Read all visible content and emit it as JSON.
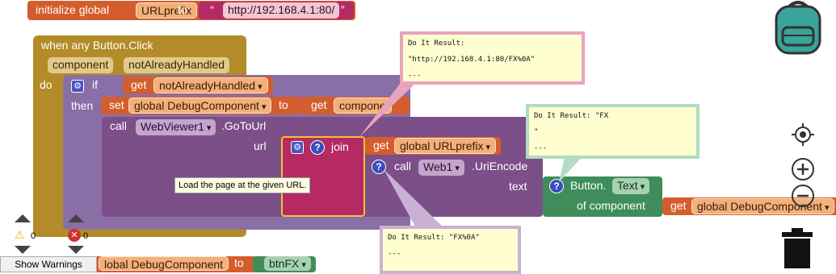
{
  "init_global": {
    "keyword": "initialize global",
    "var_name": "URLprefix",
    "to": "to",
    "open_quote": "“",
    "string_value": "http://192.168.4.1:80/",
    "close_quote": "”"
  },
  "event": {
    "title": "when any Button.Click",
    "param1": "component",
    "param2": "notAlreadyHandled",
    "do": "do"
  },
  "if_block": {
    "if": "if",
    "then": "then",
    "get": "get",
    "cond_var": "notAlreadyHandled"
  },
  "set_block": {
    "set": "set",
    "var": "global DebugComponent",
    "to": "to",
    "get": "get",
    "value": "compone"
  },
  "call_block": {
    "call": "call",
    "component": "WebViewer1",
    "method": ".GoToUrl",
    "url_label": "url"
  },
  "join_block": {
    "join": "join",
    "get": "get",
    "var": "global URLprefix"
  },
  "encode_block": {
    "call": "call",
    "component": "Web1",
    "method": ".UriEncode",
    "text_label": "text"
  },
  "button_text_block": {
    "title": "Button.",
    "prop": "Text",
    "of_component": "of component",
    "get": "get",
    "var": "global DebugComponent"
  },
  "tooltip": "Load the page at the given URL.",
  "bubbles": {
    "b1": {
      "header": "Do It Result:",
      "line2": "\"http://192.168.4.1:80/FX%0A\"",
      "line3": "---"
    },
    "b2": {
      "header": "Do It Result: \"FX",
      "line2": "\"",
      "line3": "---"
    },
    "b3": {
      "header": "Do It Result: \"FX%0A\"",
      "line2": "---"
    }
  },
  "bottom_block": {
    "partial_var": "lobal DebugComponent",
    "to": "to",
    "value": "btnFX"
  },
  "warnings": {
    "warning_count": "0",
    "error_count": "0",
    "show_warnings": "Show Warnings"
  },
  "colors": {
    "orange": "#d35d2c",
    "gold": "#b48b29",
    "purple": "#7c4f89",
    "magenta": "#b52a63",
    "green": "#3f8d5a",
    "backpack": "#3aa39a"
  },
  "icons": [
    "backpack-icon",
    "target-icon",
    "zoom-in-icon",
    "zoom-out-icon",
    "trash-icon",
    "warning-icon",
    "error-icon",
    "gear-icon",
    "help-icon"
  ]
}
